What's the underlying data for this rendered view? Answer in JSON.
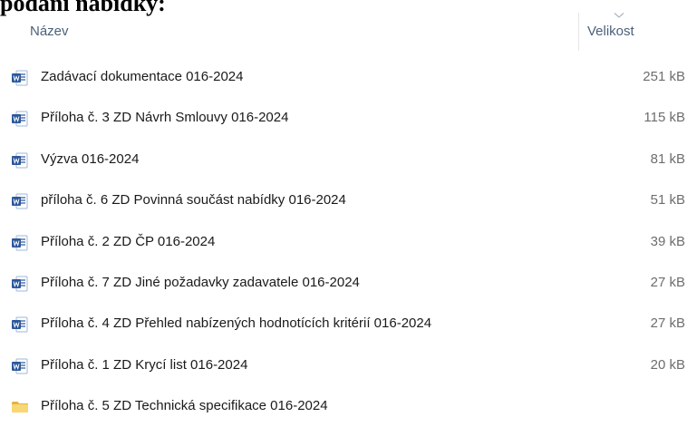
{
  "heading": "podání nabídky:",
  "columns": {
    "name": "Název",
    "size": "Velikost"
  },
  "icons": {
    "document": "word-document-icon",
    "folder": "folder-icon",
    "sort": "chevron-down-icon"
  },
  "colors": {
    "header_text": "#4c607a",
    "doc_icon": "#2b579a",
    "folder_icon": "#f4c64f"
  },
  "files": [
    {
      "name": "Zadávací dokumentace 016-2024",
      "size": "251 kB",
      "type": "doc"
    },
    {
      "name": "Příloha č. 3 ZD Návrh Smlouvy 016-2024",
      "size": "115 kB",
      "type": "doc"
    },
    {
      "name": "Výzva 016-2024",
      "size": "81 kB",
      "type": "doc"
    },
    {
      "name": "příloha č. 6 ZD Povinná součást nabídky 016-2024",
      "size": "51 kB",
      "type": "doc"
    },
    {
      "name": "Příloha č. 2 ZD ČP 016-2024",
      "size": "39 kB",
      "type": "doc"
    },
    {
      "name": "Příloha č. 7 ZD Jiné požadavky zadavatele 016-2024",
      "size": "27 kB",
      "type": "doc"
    },
    {
      "name": "Příloha č. 4 ZD Přehled nabízených hodnotících kritérií  016-2024",
      "size": "27 kB",
      "type": "doc"
    },
    {
      "name": "Příloha č. 1 ZD Krycí list 016-2024",
      "size": "20 kB",
      "type": "doc"
    },
    {
      "name": "Příloha č. 5 ZD Technická specifikace 016-2024",
      "size": "",
      "type": "folder"
    }
  ]
}
